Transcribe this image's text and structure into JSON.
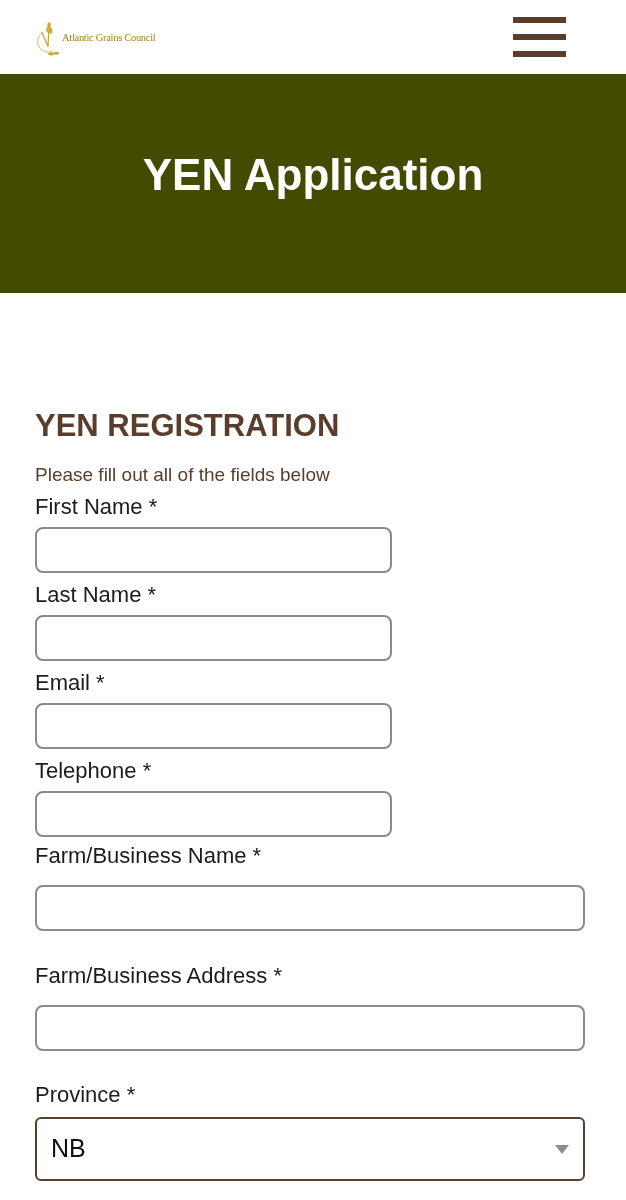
{
  "header": {
    "logo_text": "Atlantic Grains Council"
  },
  "banner": {
    "title": "YEN Application"
  },
  "form": {
    "heading": "YEN REGISTRATION",
    "intro": "Please fill out all of the fields below",
    "fields": [
      {
        "kind": "short",
        "label": "First Name *"
      },
      {
        "kind": "short",
        "label": "Last Name *"
      },
      {
        "kind": "short",
        "label": "Email *"
      },
      {
        "kind": "short",
        "label": "Telephone *"
      },
      {
        "kind": "wide",
        "label": "Farm/Business Name *"
      },
      {
        "kind": "wide",
        "label": "Farm/Business Address *"
      },
      {
        "kind": "select",
        "label": "Province *",
        "value": "NB"
      }
    ]
  }
}
